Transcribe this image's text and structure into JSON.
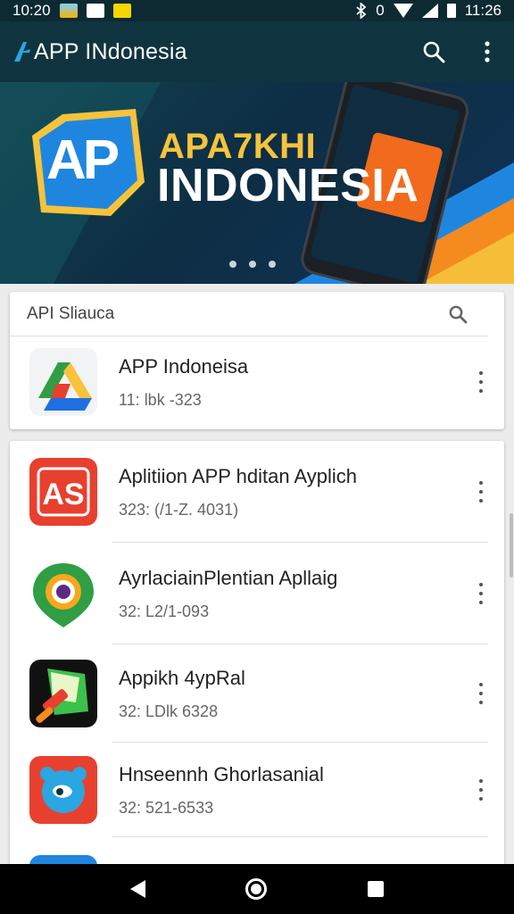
{
  "status_bar": {
    "time_left": "10:20",
    "time_right": "11:26",
    "bluetooth_status": "0",
    "icons": [
      "photo-notification-icon",
      "app-notification-icon",
      "mail-notification-icon",
      "bluetooth-icon",
      "wifi-icon",
      "signal-icon",
      "battery-icon"
    ]
  },
  "app_bar": {
    "title": "APP INdonesia",
    "logo_icon": "app-logo-icon",
    "search_icon": "search-icon",
    "more_icon": "more-vert-icon"
  },
  "banner": {
    "title_line1": "APA7KHI",
    "title_line2": "INDONESIA",
    "logo_text": "AP",
    "slide_count": 3,
    "colors": {
      "yellow": "#f6c33b",
      "orange": "#f58a1f",
      "blue": "#1f86e0"
    }
  },
  "search": {
    "label": "API Sliauca",
    "icon": "search-icon"
  },
  "featured_app": {
    "name": "APP Indoneisa",
    "meta": "11: lbk -323",
    "icon": "google-drive-style-icon"
  },
  "app_list": [
    {
      "name": "Aplitiion APP hditan Ayplich",
      "meta": "323: (/1-Z. 4031)",
      "icon": "red-ap-app-icon",
      "color": "#e8402f"
    },
    {
      "name": "AyrlaciainPlentian Apllaig",
      "meta": "32: L2/1-093",
      "icon": "green-location-gear-icon",
      "color": "#2f9e44"
    },
    {
      "name": "Appikh 4ypRal",
      "meta": "32: LDlk 6328",
      "icon": "paint-roller-app-icon",
      "color": "#111111"
    },
    {
      "name": "Hnseennh Ghorlasanial",
      "meta": "32: 521-6533",
      "icon": "blue-chat-bear-icon",
      "color": "#e8402f"
    },
    {
      "name": "",
      "meta": "",
      "icon": "partial-app-icon",
      "color": "#1f86e0"
    }
  ],
  "nav_bar": {
    "back_icon": "back-icon",
    "home_icon": "home-icon",
    "recents_icon": "recents-icon"
  }
}
